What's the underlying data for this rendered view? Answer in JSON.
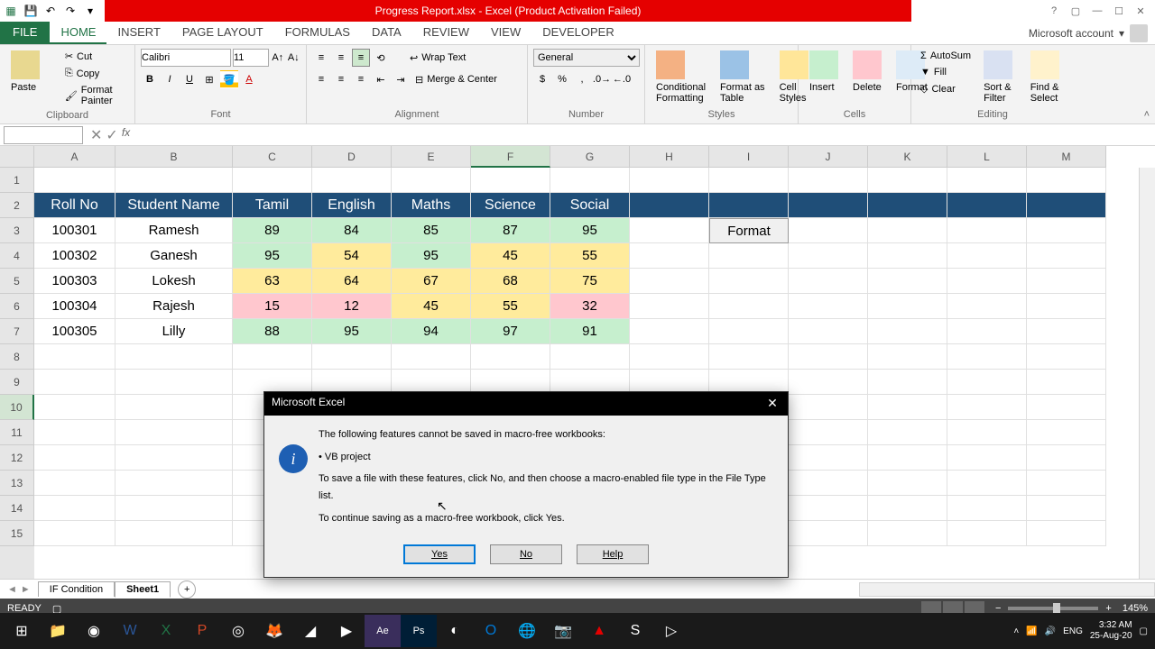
{
  "titlebar": {
    "title": "Progress Report.xlsx - Excel (Product Activation Failed)"
  },
  "tabs": {
    "file": "FILE",
    "items": [
      "HOME",
      "INSERT",
      "PAGE LAYOUT",
      "FORMULAS",
      "DATA",
      "REVIEW",
      "VIEW",
      "DEVELOPER"
    ],
    "active": "HOME",
    "account": "Microsoft account"
  },
  "ribbon": {
    "clipboard": {
      "label": "Clipboard",
      "paste": "Paste",
      "cut": "Cut",
      "copy": "Copy",
      "painter": "Format Painter"
    },
    "font": {
      "label": "Font",
      "name": "Calibri",
      "size": "11"
    },
    "alignment": {
      "label": "Alignment",
      "wrap": "Wrap Text",
      "merge": "Merge & Center"
    },
    "number": {
      "label": "Number",
      "format": "General"
    },
    "styles": {
      "label": "Styles",
      "cond": "Conditional\nFormatting",
      "table": "Format as\nTable",
      "cell": "Cell\nStyles"
    },
    "cells": {
      "label": "Cells",
      "insert": "Insert",
      "delete": "Delete",
      "format": "Format"
    },
    "editing": {
      "label": "Editing",
      "autosum": "AutoSum",
      "fill": "Fill",
      "clear": "Clear",
      "sort": "Sort &\nFilter",
      "find": "Find &\nSelect"
    }
  },
  "formula": {
    "name_box": "",
    "value": ""
  },
  "columns": [
    "A",
    "B",
    "C",
    "D",
    "E",
    "F",
    "G",
    "H",
    "I",
    "J",
    "K",
    "L",
    "M"
  ],
  "rows": [
    "1",
    "2",
    "3",
    "4",
    "5",
    "6",
    "7",
    "8",
    "9",
    "10",
    "11",
    "12",
    "13",
    "14",
    "15"
  ],
  "selected_col": "F",
  "selected_row": "10",
  "table": {
    "headers": [
      "Roll No",
      "Student Name",
      "Tamil",
      "English",
      "Maths",
      "Science",
      "Social"
    ],
    "rows": [
      {
        "roll": "100301",
        "name": "Ramesh",
        "t": "89",
        "e": "84",
        "m": "85",
        "sc": "87",
        "so": "95",
        "tc": "green",
        "ec": "green",
        "mc": "green",
        "scc": "green",
        "soc": "green"
      },
      {
        "roll": "100302",
        "name": "Ganesh",
        "t": "95",
        "e": "54",
        "m": "95",
        "sc": "45",
        "so": "55",
        "tc": "green",
        "ec": "yellow",
        "mc": "green",
        "scc": "yellow",
        "soc": "yellow"
      },
      {
        "roll": "100303",
        "name": "Lokesh",
        "t": "63",
        "e": "64",
        "m": "67",
        "sc": "68",
        "so": "75",
        "tc": "yellow",
        "ec": "yellow",
        "mc": "yellow",
        "scc": "yellow",
        "soc": "yellow"
      },
      {
        "roll": "100304",
        "name": "Rajesh",
        "t": "15",
        "e": "12",
        "m": "45",
        "sc": "55",
        "so": "32",
        "tc": "red",
        "ec": "red",
        "mc": "yellow",
        "scc": "yellow",
        "soc": "red"
      },
      {
        "roll": "100305",
        "name": "Lilly",
        "t": "88",
        "e": "95",
        "m": "94",
        "sc": "97",
        "so": "91",
        "tc": "green",
        "ec": "green",
        "mc": "green",
        "scc": "green",
        "soc": "green"
      }
    ],
    "format_btn": "Format"
  },
  "sheets": {
    "tabs": [
      "IF Condition",
      "Sheet1"
    ],
    "active": "Sheet1"
  },
  "status": {
    "ready": "READY",
    "zoom": "145%"
  },
  "dialog": {
    "title": "Microsoft Excel",
    "line1": "The following features cannot be saved in macro-free workbooks:",
    "line2": "• VB project",
    "line3": "To save a file with these features, click No, and then choose a macro-enabled file type in the File Type list.",
    "line4": "To continue saving as a macro-free workbook, click Yes.",
    "yes": "Yes",
    "no": "No",
    "help": "Help"
  },
  "taskbar": {
    "lang": "ENG",
    "time": "3:32 AM",
    "date": "25-Aug-20"
  }
}
